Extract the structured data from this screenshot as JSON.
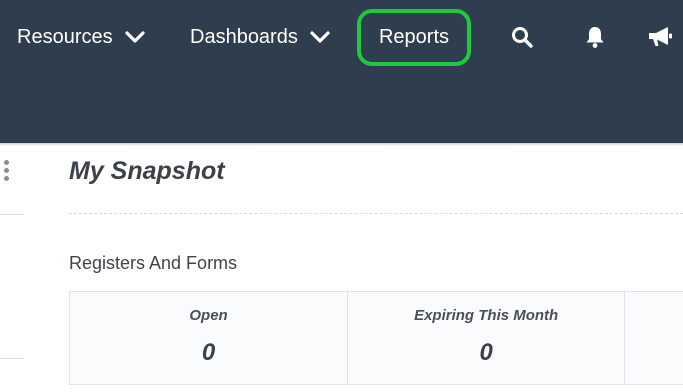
{
  "nav": {
    "items": [
      {
        "label": "Resources",
        "has_dropdown": true
      },
      {
        "label": "Dashboards",
        "has_dropdown": true
      },
      {
        "label": "Reports",
        "has_dropdown": false,
        "highlighted": true
      }
    ],
    "icons": [
      "search-icon",
      "bell-icon",
      "megaphone-icon"
    ]
  },
  "page": {
    "title": "My Snapshot",
    "section_heading": "Registers And Forms"
  },
  "stats": [
    {
      "label": "Open",
      "value": "0"
    },
    {
      "label": "Expiring This Month",
      "value": "0"
    },
    {
      "label": "",
      "value": ""
    }
  ],
  "colors": {
    "nav_background": "#2e3e4f",
    "highlight": "#1fc93c",
    "nav_text": "#ffffff"
  }
}
